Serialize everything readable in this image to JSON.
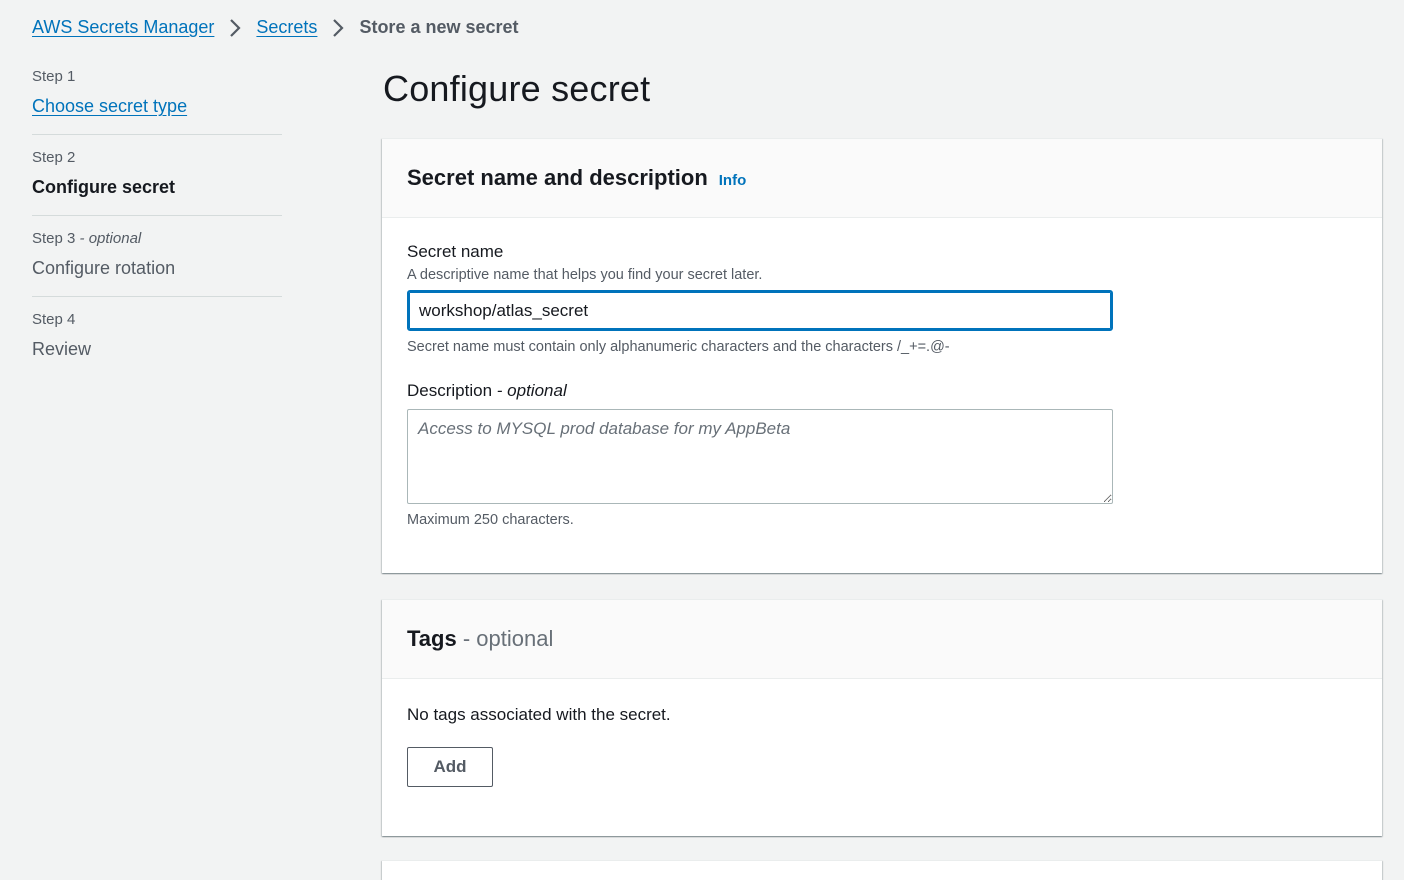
{
  "breadcrumb": {
    "items": [
      "AWS Secrets Manager",
      "Secrets"
    ],
    "current": "Store a new secret"
  },
  "steps": [
    {
      "num": "Step 1",
      "label": "Choose secret type"
    },
    {
      "num": "Step 2",
      "label": "Configure secret"
    },
    {
      "num": "Step 3",
      "optional": "- optional",
      "label": "Configure rotation"
    },
    {
      "num": "Step 4",
      "label": "Review"
    }
  ],
  "page": {
    "title": "Configure secret"
  },
  "secret_panel": {
    "title": "Secret name and description",
    "info": "Info",
    "name_label": "Secret name",
    "name_desc": "A descriptive name that helps you find your secret later.",
    "name_value": "workshop/atlas_secret",
    "name_constraint": "Secret name must contain only alphanumeric characters and the characters /_+=.@-",
    "desc_label": "Description",
    "desc_optional": "- optional",
    "desc_placeholder": "Access to MYSQL prod database for my AppBeta",
    "desc_max": "Maximum 250 characters."
  },
  "tags_panel": {
    "title": "Tags",
    "optional": "- optional",
    "empty_text": "No tags associated with the secret.",
    "add_label": "Add"
  },
  "colors": {
    "link": "#0073bb",
    "background": "#f2f3f3",
    "text": "#16191f",
    "muted": "#545b64"
  },
  "icons": {
    "breadcrumb_separator": "chevron-right-icon"
  }
}
